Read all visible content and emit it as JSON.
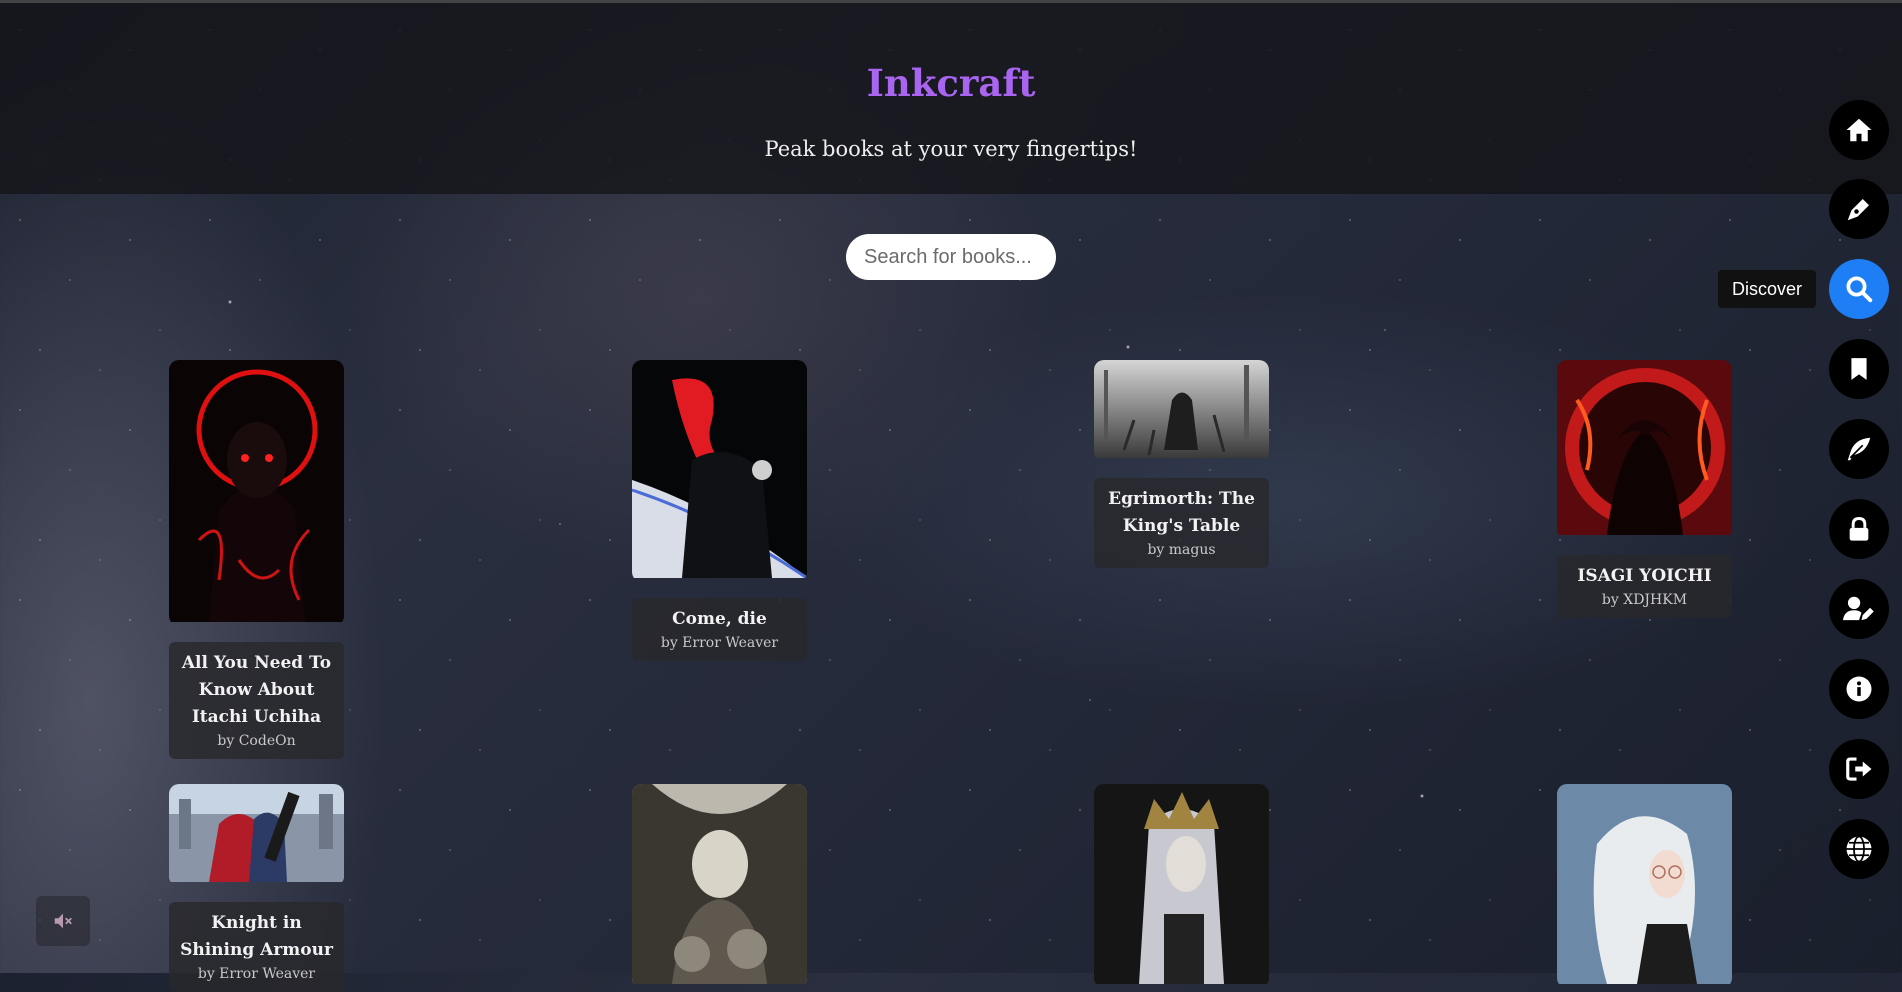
{
  "header": {
    "title": "Inkcraft",
    "tagline": "Peak books at your very fingertips!"
  },
  "search": {
    "placeholder": "Search for books..."
  },
  "books": [
    {
      "title": "All You Need To Know About Itachi Uchiha",
      "author": "by CodeOn"
    },
    {
      "title": "Come, die",
      "author": "by Error Weaver"
    },
    {
      "title": "Egrimorth: The King's Table",
      "author": "by magus"
    },
    {
      "title": "ISAGI YOICHI",
      "author": "by XDJHKM"
    },
    {
      "title": "Knight in Shining Armour",
      "author": "by Error Weaver"
    }
  ],
  "nav": {
    "items": [
      {
        "icon": "home-icon"
      },
      {
        "icon": "pen-icon"
      },
      {
        "icon": "search-icon",
        "active": true,
        "tooltip": "Discover"
      },
      {
        "icon": "bookmark-icon"
      },
      {
        "icon": "feather-icon"
      },
      {
        "icon": "lock-icon"
      },
      {
        "icon": "user-edit-icon"
      },
      {
        "icon": "info-icon"
      },
      {
        "icon": "logout-icon"
      },
      {
        "icon": "globe-icon"
      }
    ]
  },
  "colors": {
    "title_purple": "#a964f0",
    "active_blue": "#1e7ef5"
  }
}
